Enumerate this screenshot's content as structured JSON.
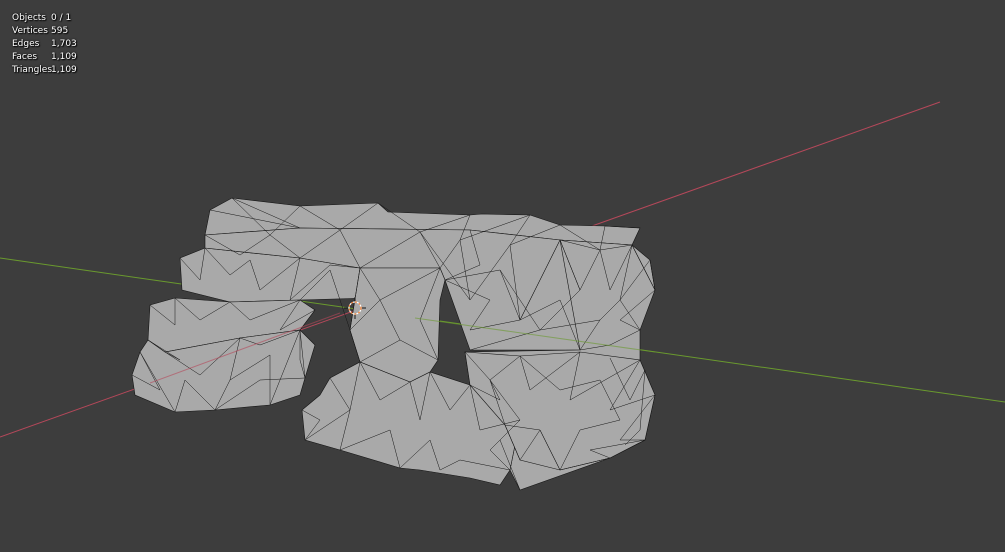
{
  "app": "3D viewport",
  "overlay": {
    "statistics": [
      {
        "label": "Objects",
        "value": "0 / 1"
      },
      {
        "label": "Vertices",
        "value": "595"
      },
      {
        "label": "Edges",
        "value": "1,703"
      },
      {
        "label": "Faces",
        "value": "1,109"
      },
      {
        "label": "Triangles",
        "value": "1,109"
      }
    ]
  },
  "colors": {
    "background": "#3d3d3d",
    "x_axis": "#b5485a",
    "y_axis": "#6a9a2e",
    "mesh_fill": "#a9a9a9",
    "mesh_wire": "#151515",
    "origin_marker": "#ff8a3d"
  },
  "scene": {
    "object": "rock-mesh",
    "shading": "solid-with-wireframe",
    "origin_icon": "3d-cursor-icon"
  }
}
